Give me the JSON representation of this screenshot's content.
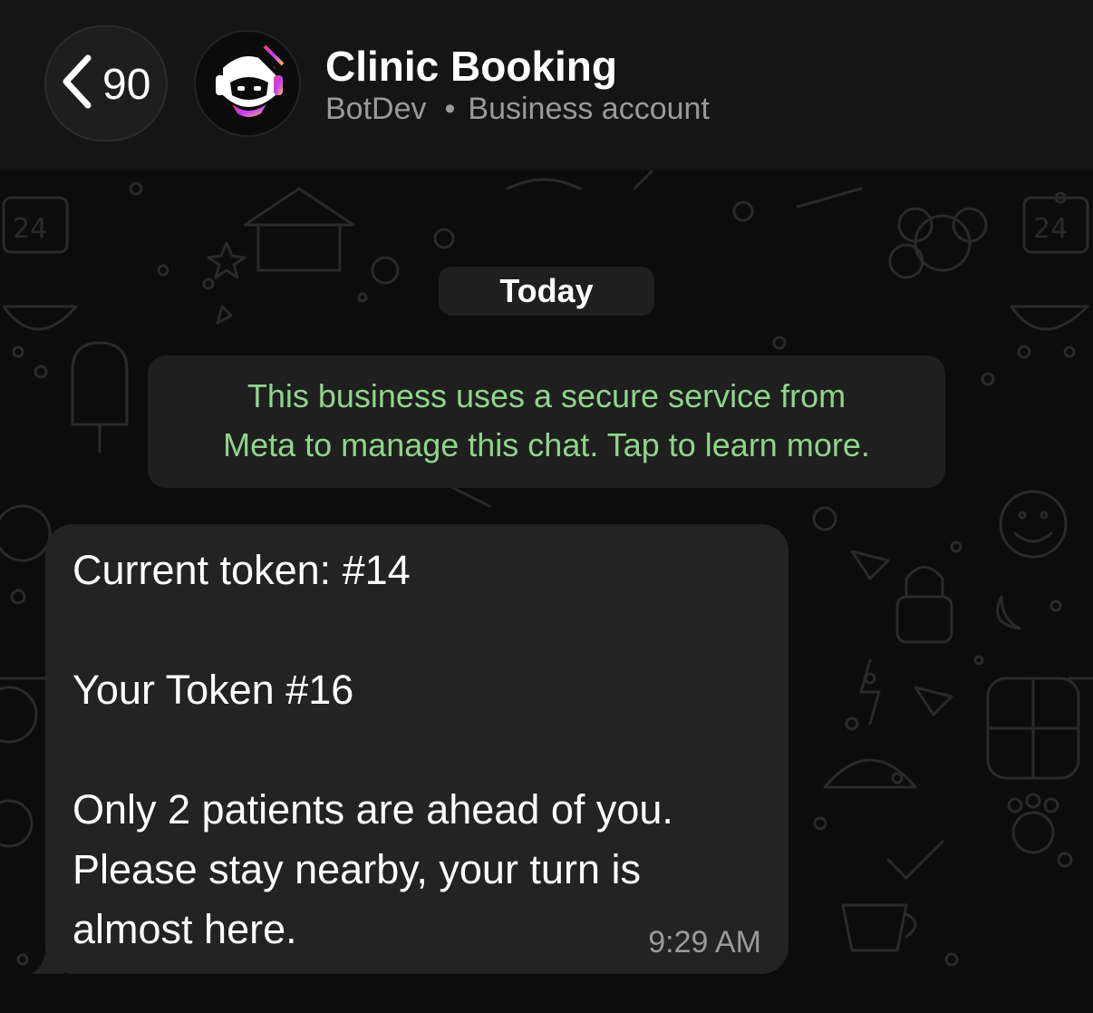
{
  "header": {
    "back_count": "90",
    "title": "Clinic Booking",
    "subtitle_name": "BotDev",
    "subtitle_separator": "•",
    "subtitle_type": "Business account"
  },
  "chat": {
    "date_label": "Today",
    "notice_line1": "This business uses a secure service from",
    "notice_line2": "Meta to manage this chat. Tap to learn more.",
    "message": {
      "line1": "Current token: #14",
      "line2": "",
      "line3": "Your Token #16",
      "line4": "",
      "line5": "Only 2 patients are ahead of you.",
      "line6": "Please stay nearby, your turn is",
      "line7": "almost here.",
      "time": "9:29 AM"
    }
  },
  "colors": {
    "header_bg": "#151515",
    "chat_bg": "#0c0c0c",
    "bubble_bg": "#232323",
    "notice_text": "#8fd58b",
    "secondary_text": "#9a9a9a"
  },
  "icons": {
    "back": "chevron-left-icon",
    "avatar": "bot-logo-icon"
  }
}
